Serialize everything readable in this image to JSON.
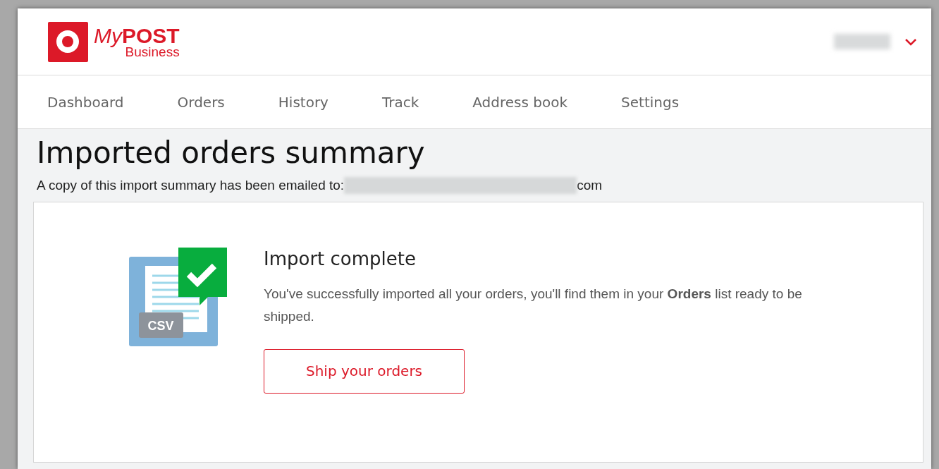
{
  "logo": {
    "my": "My",
    "post": "POST",
    "business": "Business"
  },
  "nav": [
    {
      "label": "Dashboard",
      "selected": false
    },
    {
      "label": "Orders",
      "selected": false
    },
    {
      "label": "History",
      "selected": false
    },
    {
      "label": "Track",
      "selected": false
    },
    {
      "label": "Address book",
      "selected": false
    },
    {
      "label": "Settings",
      "selected": false
    }
  ],
  "page": {
    "title": "Imported orders summary",
    "email_note": "A copy of this import summary has been emailed to:",
    "email_suffix": "com"
  },
  "result": {
    "badge": "CSV",
    "heading": "Import complete",
    "message": "You've successfully imported all your orders, you'll find them in your **Orders** list ready to be shipped.",
    "button": "Ship your orders"
  }
}
